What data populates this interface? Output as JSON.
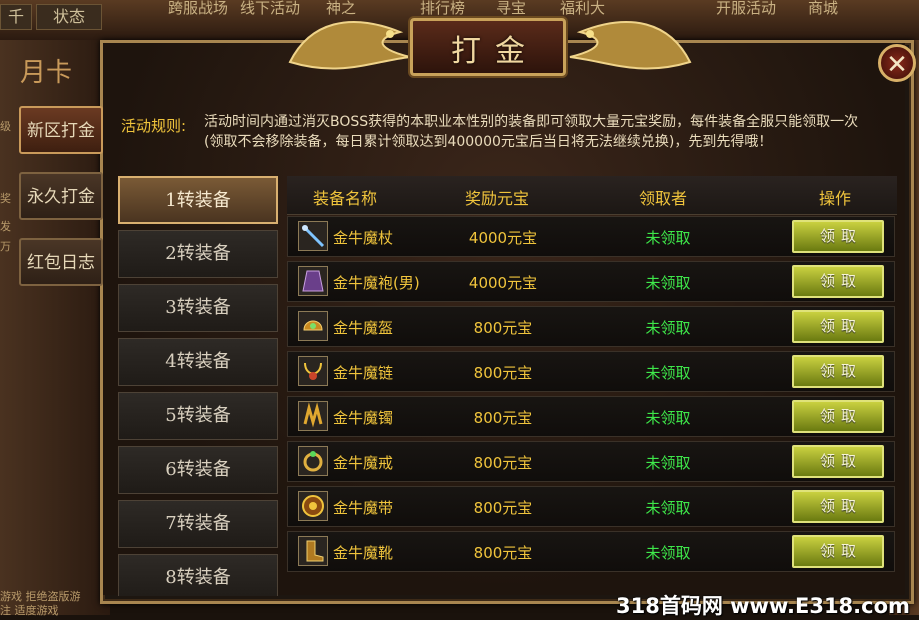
{
  "background": {
    "top_tabs": [
      "千",
      "状态"
    ],
    "top_nav": [
      "跨服战场",
      "线下活动",
      "神之",
      "排行榜",
      "寻宝",
      "福利大",
      "开服活动",
      "商城"
    ],
    "left_scraps": [
      "月卡",
      "级",
      "奖",
      "发",
      "万",
      "游戏 拒绝盗版游",
      "注 适度游戏"
    ],
    "watermark": "318首码网 www.E318.com"
  },
  "dialog": {
    "title": "打金",
    "close_icon": "close-icon"
  },
  "side_tabs": [
    {
      "label": "新区打金",
      "active": true
    },
    {
      "label": "永久打金",
      "active": false
    },
    {
      "label": "红包日志",
      "active": false
    }
  ],
  "rules": {
    "label": "活动规则:",
    "text": "活动时间内通过消灭BOSS获得的本职业本性别的装备即可领取大量元宝奖励，每件装备全服只能领取一次(领取不会移除装备，每日累计领取达到400000元宝后当日将无法继续兑换)，先到先得哦！"
  },
  "categories": [
    "1转装备",
    "2转装备",
    "3转装备",
    "4转装备",
    "5转装备",
    "6转装备",
    "7转装备",
    "8转装备"
  ],
  "active_category": 0,
  "table": {
    "headers": [
      "装备名称",
      "奖励元宝",
      "领取者",
      "操作"
    ],
    "rows": [
      {
        "icon": "staff-icon",
        "name": "金牛魔杖",
        "reward": "4000元宝",
        "status": "未领取",
        "action": "领取"
      },
      {
        "icon": "robe-icon",
        "name": "金牛魔袍(男)",
        "reward": "4000元宝",
        "status": "未领取",
        "action": "领取"
      },
      {
        "icon": "helmet-icon",
        "name": "金牛魔盔",
        "reward": "800元宝",
        "status": "未领取",
        "action": "领取"
      },
      {
        "icon": "necklace-icon",
        "name": "金牛魔链",
        "reward": "800元宝",
        "status": "未领取",
        "action": "领取"
      },
      {
        "icon": "bracelet-icon",
        "name": "金牛魔镯",
        "reward": "800元宝",
        "status": "未领取",
        "action": "领取"
      },
      {
        "icon": "ring-icon",
        "name": "金牛魔戒",
        "reward": "800元宝",
        "status": "未领取",
        "action": "领取"
      },
      {
        "icon": "belt-icon",
        "name": "金牛魔带",
        "reward": "800元宝",
        "status": "未领取",
        "action": "领取"
      },
      {
        "icon": "boots-icon",
        "name": "金牛魔靴",
        "reward": "800元宝",
        "status": "未领取",
        "action": "领取"
      }
    ]
  },
  "colors": {
    "gold_text": "#f0c43c",
    "unclaimed_green": "#3ee84a",
    "claim_button": "#a8b42a",
    "frame_gold": "#c9a25a"
  }
}
